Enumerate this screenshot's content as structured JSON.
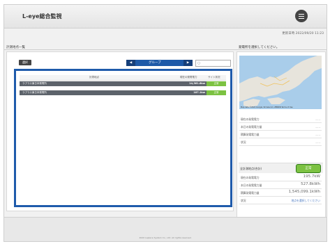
{
  "app": {
    "title": "L-eye総合監視"
  },
  "status": {
    "updated": "更新日時 2022/09/20 11:23"
  },
  "left": {
    "section_title": "計測地点一覧",
    "select_label": "選択",
    "group_label": "グループ",
    "prev_label": "◀",
    "next_label": "▶",
    "search_placeholder": "",
    "columns": [
      "計測地点",
      "現在の発電電力",
      "サイト状況"
    ],
    "rows": [
      {
        "name": "ラプラス東日本発電所",
        "value": "14,361.8kw",
        "status": "正常"
      },
      {
        "name": "ラプラス東日本発電所",
        "value": "187.1kw",
        "status": "正常"
      }
    ]
  },
  "right": {
    "section_title": "発電所を選択してください。",
    "map_credit": "Map data ©2022 Google, SK telecom, ZENRIN  Terms of Use",
    "details": [
      {
        "label": "現在の発電電力",
        "value": "- - -"
      },
      {
        "label": "本日の発電電力量",
        "value": "- - -"
      },
      {
        "label": "積算発電電力量",
        "value": "- - -"
      },
      {
        "label": "状況",
        "value": "- - -"
      }
    ],
    "total_title": "全計測地点(合計)",
    "total_status": "正常",
    "totals": [
      {
        "label": "現在の発電電力",
        "value": "195.7kW"
      },
      {
        "label": "本日の発電電力量",
        "value": "527.8kWh"
      },
      {
        "label": "積算発電電力量",
        "value": "1,545,099.1kWh"
      },
      {
        "label": "状況",
        "value": "地点を選択してください"
      }
    ]
  },
  "footer": {
    "copyright": "2020 Laplace System Co., Ltd. All rights reserved."
  },
  "colors": {
    "highlight": "#1f5bab",
    "status_ok": "#7cc242",
    "row_bg": "#5d636b"
  }
}
